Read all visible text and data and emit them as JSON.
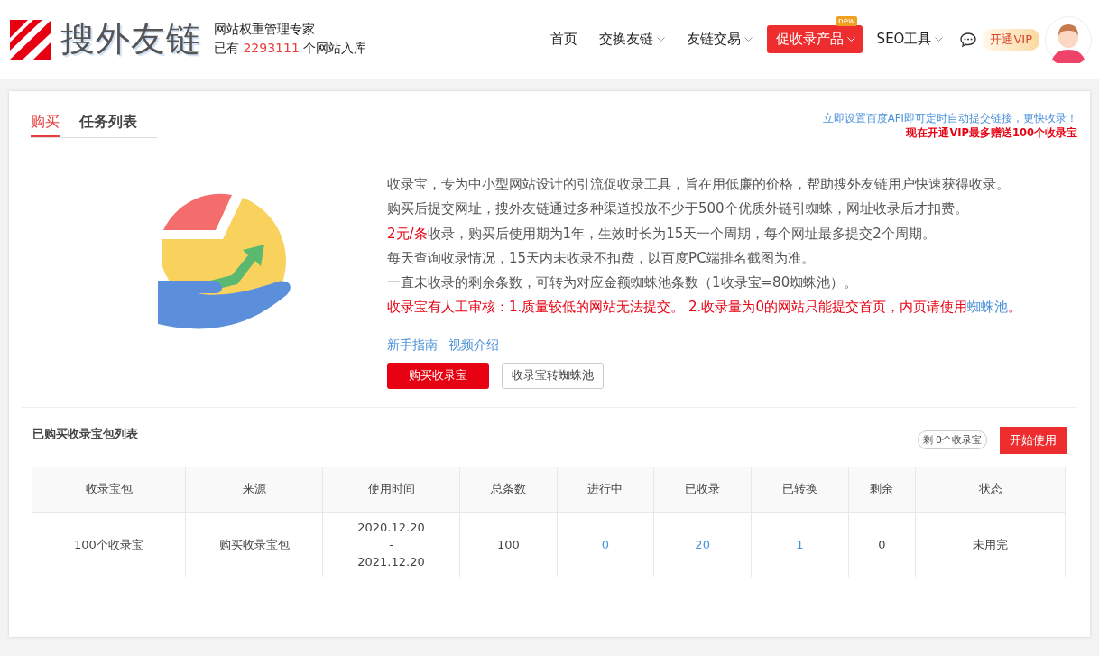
{
  "header": {
    "logo_text": "搜外友链",
    "tagline": "网站权重管理专家",
    "count_prefix": "已有",
    "count": "2293111",
    "count_suffix": "个网站入库"
  },
  "nav": [
    {
      "label": "首页",
      "dropdown": false,
      "selected": false
    },
    {
      "label": "交换友链",
      "dropdown": true,
      "selected": false
    },
    {
      "label": "友链交易",
      "dropdown": true,
      "selected": false
    },
    {
      "label": "促收录产品",
      "dropdown": true,
      "selected": true,
      "badge": "new"
    },
    {
      "label": "SEO工具",
      "dropdown": true,
      "selected": false
    }
  ],
  "vip_button": "开通VIP",
  "tabs": [
    {
      "label": "购买",
      "selected": true
    },
    {
      "label": "任务列表",
      "selected": false
    }
  ],
  "notice": {
    "link": "立即设置百度API即可定时自动提交链接，更快收录！",
    "promo": "现在开通VIP最多赠送100个收录宝"
  },
  "intro": [
    [
      {
        "text": "收录宝，专为中小型网站设计的引流促收录工具，旨在用低廉的价格，帮助搜外友链用户快速获得收录。",
        "kind": "plain"
      }
    ],
    [
      {
        "text": "购买后提交网址，搜外友链通过多种渠道投放不少于500个优质外链引蜘蛛，网址收录后才扣费。",
        "kind": "plain"
      }
    ],
    [
      {
        "text": "2元/条",
        "kind": "red"
      },
      {
        "text": "收录，购买后使用期为1年，生效时长为15天一个周期，每个网址最多提交2个周期。",
        "kind": "plain"
      }
    ],
    [
      {
        "text": "每天查询收录情况，15天内未收录不扣费，以百度PC端排名截图为准。",
        "kind": "plain"
      }
    ],
    [
      {
        "text": "一直未收录的剩余条数，可转为对应金额蜘蛛池条数（1收录宝=80蜘蛛池）。",
        "kind": "plain"
      }
    ],
    [
      {
        "text": "收录宝有人工审核：1.质量较低的网站无法提交。 2.收录量为0的网站只能提交首页，内页请使用",
        "kind": "red"
      },
      {
        "text": "蜘蛛池",
        "kind": "link"
      },
      {
        "text": "。",
        "kind": "red"
      }
    ]
  ],
  "guide_links": [
    "新手指南",
    "视频介绍"
  ],
  "actions": {
    "primary": "购买收录宝",
    "secondary": "收录宝转蜘蛛池"
  },
  "packages": {
    "title": "已购买收录宝包列表",
    "remaining": "剩 0个收录宝",
    "start_button": "开始使用",
    "columns": [
      "收录宝包",
      "来源",
      "使用时间",
      "总条数",
      "进行中",
      "已收录",
      "已转换",
      "剩余",
      "状态"
    ],
    "rows": [
      [
        {
          "lines": [
            "100个收录宝"
          ],
          "kind": "plain"
        },
        {
          "lines": [
            "购买收录宝包"
          ],
          "kind": "plain"
        },
        {
          "lines": [
            "2020.12.20",
            "-",
            "2021.12.20"
          ],
          "kind": "plain"
        },
        {
          "lines": [
            "100"
          ],
          "kind": "plain"
        },
        {
          "lines": [
            "0"
          ],
          "kind": "link"
        },
        {
          "lines": [
            "20"
          ],
          "kind": "link"
        },
        {
          "lines": [
            "1"
          ],
          "kind": "link"
        },
        {
          "lines": [
            "0"
          ],
          "kind": "plain"
        },
        {
          "lines": [
            "未用完"
          ],
          "kind": "plain"
        }
      ]
    ]
  }
}
